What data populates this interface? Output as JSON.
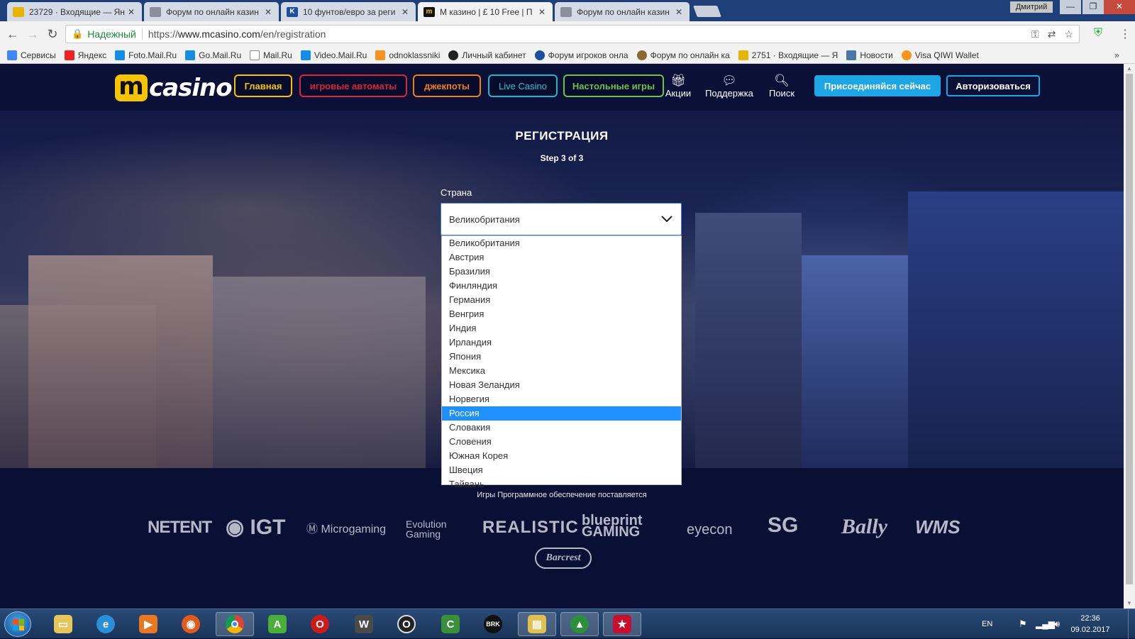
{
  "browser": {
    "tabs": [
      {
        "title": "23729 · Входящие — Ян",
        "icon_color": "#e8b400",
        "icon_text": ""
      },
      {
        "title": "Форум по онлайн казин",
        "icon_color": "#8a8f9a",
        "icon_text": ""
      },
      {
        "title": "10 фунтов/евро за реги",
        "icon_color": "#1d4fa0",
        "icon_text": "K"
      },
      {
        "title": "М казино | £ 10 Free | П",
        "icon_color": "#111111",
        "icon_text": "m"
      },
      {
        "title": "Форум по онлайн казин",
        "icon_color": "#8a8f9a",
        "icon_text": ""
      }
    ],
    "profile_name": "Дмитрий",
    "secure_label": "Надежный",
    "url_scheme": "https://",
    "url_host": "www.mcasino.com",
    "url_path": "/en/registration",
    "bookmarks": [
      {
        "label": "Сервисы",
        "color": "#4285f4",
        "icon": "grid-icon"
      },
      {
        "label": "Яндекс",
        "color": "#e22",
        "icon": "yandex-icon"
      },
      {
        "label": "Foto.Mail.Ru",
        "color": "#168de2",
        "icon": "mailru-icon"
      },
      {
        "label": "Go.Mail.Ru",
        "color": "#168de2",
        "icon": "mailru-icon"
      },
      {
        "label": "Mail.Ru",
        "color": "#888",
        "icon": "page-icon"
      },
      {
        "label": "Video.Mail.Ru",
        "color": "#168de2",
        "icon": "mailru-icon"
      },
      {
        "label": "odnoklassniki",
        "color": "#f7931e",
        "icon": "ok-icon"
      },
      {
        "label": "Личный кабинет",
        "color": "#222",
        "icon": "cabinet-icon"
      },
      {
        "label": "Форум игроков онла",
        "color": "#1d4fa0",
        "icon": "forum-icon"
      },
      {
        "label": "Форум по онлайн ка",
        "color": "#8a6a30",
        "icon": "forum-icon"
      },
      {
        "label": "2751 · Входящие — Я",
        "color": "#e8b400",
        "icon": "mail-icon"
      },
      {
        "label": "Новости",
        "color": "#4a76a8",
        "icon": "vk-icon"
      },
      {
        "label": "Visa QIWI Wallet",
        "color": "#f7931e",
        "icon": "qiwi-icon"
      }
    ]
  },
  "site": {
    "logo_m": "m",
    "logo_text": "casino",
    "nav": [
      {
        "label": "Главная",
        "color": "#f5c400",
        "text_color": "#f5c400"
      },
      {
        "label": "игровые автоматы",
        "color": "#d9263a",
        "text_color": "#d9263a"
      },
      {
        "label": "джекпоты",
        "color": "#ee7f1f",
        "text_color": "#ee7f1f"
      },
      {
        "label": "Live Casino",
        "color": "#20b5c9",
        "text_color": "#20c5d9"
      },
      {
        "label": "Настольные игры",
        "color": "#6cc24a",
        "text_color": "#6cc24a"
      }
    ],
    "icons": [
      {
        "label": "Акции",
        "icon": "gift-icon"
      },
      {
        "label": "Поддержка",
        "icon": "chat-icon"
      },
      {
        "label": "Поиск",
        "icon": "search-icon"
      }
    ],
    "join_label": "Присоединяйся сейчас",
    "login_label": "Авторизоваться",
    "accent": "#1ea5e6"
  },
  "registration": {
    "title": "РЕГИСТРАЦИЯ",
    "step": "Step 3 of 3",
    "country_label": "Страна",
    "selected_country": "Великобритания",
    "options": [
      "Великобритания",
      "Австрия",
      "Бразилия",
      "Финляндия",
      "Германия",
      "Венгрия",
      "Индия",
      "Ирландия",
      "Япония",
      "Мексика",
      "Новая Зеландия",
      "Норвегия",
      "Россия",
      "Словакия",
      "Словения",
      "Южная Корея",
      "Швеция",
      "Тайвань"
    ],
    "highlighted_option": "Россия"
  },
  "footer": {
    "caption": "Игры Программное обеспечение поставляется",
    "providers": [
      "NETENT",
      "IGT",
      "Microgaming",
      "Evolution Gaming",
      "REALISTIC",
      "blueprint GAMING",
      "eyecon",
      "SG",
      "Bally",
      "WMS",
      "Barcrest"
    ]
  },
  "taskbar": {
    "apps": [
      {
        "name": "explorer",
        "color": "#e8c55a",
        "glyph": "📁"
      },
      {
        "name": "internet-explorer",
        "color": "#2a8fd8",
        "glyph": "e"
      },
      {
        "name": "media-player",
        "color": "#e87722",
        "glyph": "▶"
      },
      {
        "name": "firefox",
        "color": "#e25a1c",
        "glyph": "◉"
      },
      {
        "name": "chrome",
        "color": "#3b9b4a",
        "glyph": "◎"
      },
      {
        "name": "app-a",
        "color": "#4cae3a",
        "glyph": "A"
      },
      {
        "name": "opera",
        "color": "#cc1b1b",
        "glyph": "O"
      },
      {
        "name": "world-of-tanks",
        "color": "#4a4a4a",
        "glyph": "W"
      },
      {
        "name": "opera-neon",
        "color": "#222",
        "glyph": "O"
      },
      {
        "name": "camtasia",
        "color": "#3a8f3a",
        "glyph": "C"
      },
      {
        "name": "brk",
        "color": "#111",
        "glyph": "BRK"
      },
      {
        "name": "folder",
        "color": "#e0c050",
        "glyph": "▤"
      },
      {
        "name": "monitor",
        "color": "#2b8f3c",
        "glyph": "▲"
      },
      {
        "name": "pokerstars",
        "color": "#c8102e",
        "glyph": "★"
      }
    ],
    "language": "EN",
    "time": "22:36",
    "date": "09.02.2017"
  }
}
